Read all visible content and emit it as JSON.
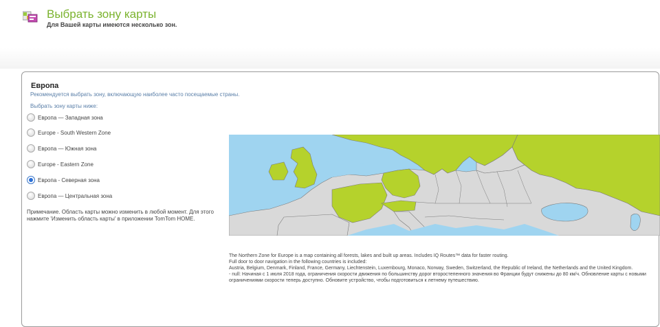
{
  "header": {
    "title": "Выбрать зону карты",
    "subtitle": "Для Вашей карты имеются несколько зон.",
    "icon": "map-zones-icon"
  },
  "region": {
    "title": "Европа",
    "recommendation": "Рекомендуется выбрать зону, включающую наиболее часто посещаемые страны.",
    "choose_label": "Выбрать зону карты ниже:"
  },
  "zones": [
    {
      "label": "Европа — Западная зона",
      "selected": false
    },
    {
      "label": "Europe - South Western Zone",
      "selected": false
    },
    {
      "label": "Европа — Южная зона",
      "selected": false
    },
    {
      "label": "Europe - Eastern Zone",
      "selected": false
    },
    {
      "label": "Европа - Северная зона",
      "selected": true
    },
    {
      "label": "Европа — Центральная зона",
      "selected": false
    }
  ],
  "note": "Примечание. Область карты можно изменить в любой момент. Для этого нажмите 'Изменить область карты' в приложении TomTom HOME.",
  "description": {
    "line1": "The Northern Zone for Europe is a map containing all forests, lakes and built up areas. Includes IQ Routes™ data for faster routing.",
    "line2": "Full door to door navigation in the following countries is included:",
    "line3": "Austria, Belgium, Denmark, Finland, France, Germany, Liechtenstein, Luxembourg, Monaco, Norway, Sweden, Switzerland, the Republic of Ireland, the Netherlands and the United Kingdom.",
    "line4": "- null: Начиная с 1 июля 2018 года, ограничения скорости движения по большинству дорог второстепенного значения во Франции будут снижены до 80 км/ч. Обновление карты с новыми ограничениями скорости теперь доступно. Обновите устройство, чтобы подготовиться к летнему путешествию."
  },
  "map_colors": {
    "sea": "#9fd4f0",
    "selected_land": "#b5d22c",
    "other_land": "#d9d9d9",
    "border": "#7a7a7a"
  }
}
